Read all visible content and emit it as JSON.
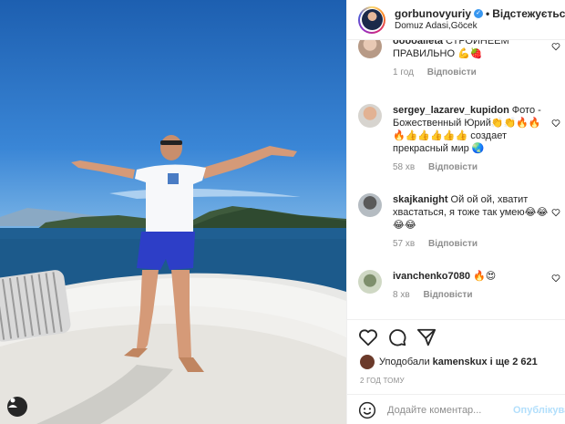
{
  "post": {
    "author": "gorbunovyuriy",
    "separator": "•",
    "follow_label": "Відстежується",
    "location": "Domuz Adasi,Göcek"
  },
  "comments": [
    {
      "user": "ooooalieta",
      "text": "СТРОЙНЕЕМ ПРАВИЛЬНО 💪🍓",
      "time": "1 год",
      "reply_label": "Відповісти"
    },
    {
      "user": "sergey_lazarev_kupidon",
      "text": "Фото - Божественный Юрий👏👏🔥🔥🔥👍👍👍👍👍 создает прекрасный мир 🌏",
      "time": "58 хв",
      "reply_label": "Відповісти"
    },
    {
      "user": "skajkanight",
      "text": "Ой ой ой, хватит хвастаться, я тоже так умею😂😂😂😂",
      "time": "57 хв",
      "reply_label": "Відповісти"
    },
    {
      "user": "ivanchenko7080",
      "text": "🔥😍",
      "time": "8 хв",
      "reply_label": "Відповісти"
    }
  ],
  "likes": {
    "prefix": "Уподобали",
    "user": "kamenskux",
    "suffix": "і ще 2 621"
  },
  "timestamp": "2 ГОД ТОМУ",
  "add_comment": {
    "placeholder": "Додайте коментар...",
    "publish_label": "Опублікувати"
  },
  "icons": {
    "like": "heart-icon",
    "comment": "comment-bubble-icon",
    "share": "paper-plane-icon",
    "emoji": "smiley-icon",
    "tagged": "user-tag-icon",
    "verified": "verified-badge-icon"
  },
  "colors": {
    "verified": "#3897f0",
    "muted": "#8e8e8e",
    "publish_disabled": "#b2dffc",
    "text": "#262626"
  }
}
